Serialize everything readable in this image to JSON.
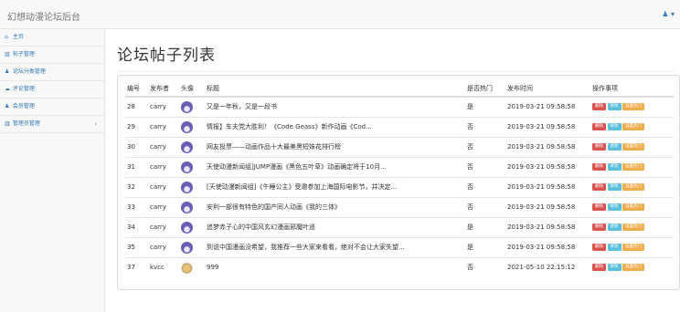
{
  "app": {
    "brand": "幻想动漫论坛后台",
    "user_menu": "♟ ▾"
  },
  "sidebar": {
    "items": [
      {
        "icon": "dashboard-icon",
        "glyph": "⌂",
        "label": "主页"
      },
      {
        "icon": "bar-chart-icon",
        "glyph": "▥",
        "label": "帖子管理"
      },
      {
        "icon": "user-icon",
        "glyph": "♟",
        "label": "论坛分类管理"
      },
      {
        "icon": "comments-icon",
        "glyph": "☁",
        "label": "评论管理"
      },
      {
        "icon": "user-icon",
        "glyph": "♟",
        "label": "会员管理"
      },
      {
        "icon": "bar-chart-icon",
        "glyph": "▥",
        "label": "管理员管理",
        "arrow": "‹"
      }
    ]
  },
  "page": {
    "title": "论坛帖子列表"
  },
  "table": {
    "headers": [
      "编号",
      "发布者",
      "头像",
      "标题",
      "是否热门",
      "发布时间",
      "操作事项"
    ],
    "buttons": {
      "delete": "删除",
      "edit": "修改",
      "hot": "设置热门"
    },
    "rows": [
      {
        "id": "28",
        "author": "carry",
        "avatar": "purple",
        "title": "又是一年秋，又是一段书",
        "hot": "是",
        "time": "2019-03-21 09:58:58"
      },
      {
        "id": "29",
        "author": "carry",
        "avatar": "purple",
        "title": "情报】车夫党大胜利！《Code Geass》新作动画《Cod...",
        "hot": "否",
        "time": "2019-03-21 09:58:58"
      },
      {
        "id": "30",
        "author": "carry",
        "avatar": "purple",
        "title": "网友投票——动画作品十大最美黑短妹花排行榜",
        "hot": "否",
        "time": "2019-03-21 09:58:58"
      },
      {
        "id": "31",
        "author": "carry",
        "avatar": "purple",
        "title": "天使动漫新闻组]JUMP漫画《黑色五叶草》动画确定将于10月...",
        "hot": "否",
        "time": "2019-03-21 09:58:58"
      },
      {
        "id": "32",
        "author": "carry",
        "avatar": "purple",
        "title": "[天使动漫新闻组]《午睡公主》受邀参加上海国际电影节，并决定...",
        "hot": "否",
        "time": "2019-03-21 09:58:58"
      },
      {
        "id": "33",
        "author": "carry",
        "avatar": "purple",
        "title": "安利一部很有特色的国产同人动画《我的三体》",
        "hot": "否",
        "time": "2019-03-21 09:58:58"
      },
      {
        "id": "34",
        "author": "carry",
        "avatar": "purple",
        "title": "追梦赤子心的中国风玄幻漫画邪魔叶遥",
        "hot": "是",
        "time": "2019-03-21 09:58:58"
      },
      {
        "id": "35",
        "author": "carry",
        "avatar": "purple",
        "title": "到说中国漫画没希望，我推荐一些大家来看看，绝对不会让大家失望...",
        "hot": "是",
        "time": "2019-03-21 09:58:58"
      },
      {
        "id": "37",
        "author": "kvcc",
        "avatar": "dog",
        "title": "999",
        "hot": "否",
        "time": "2021-05-10 22:15:12"
      }
    ]
  },
  "colors": {
    "delete": "#d9534f",
    "edit": "#5bc0de",
    "hot": "#f0ad4e",
    "link": "#337ab7"
  }
}
